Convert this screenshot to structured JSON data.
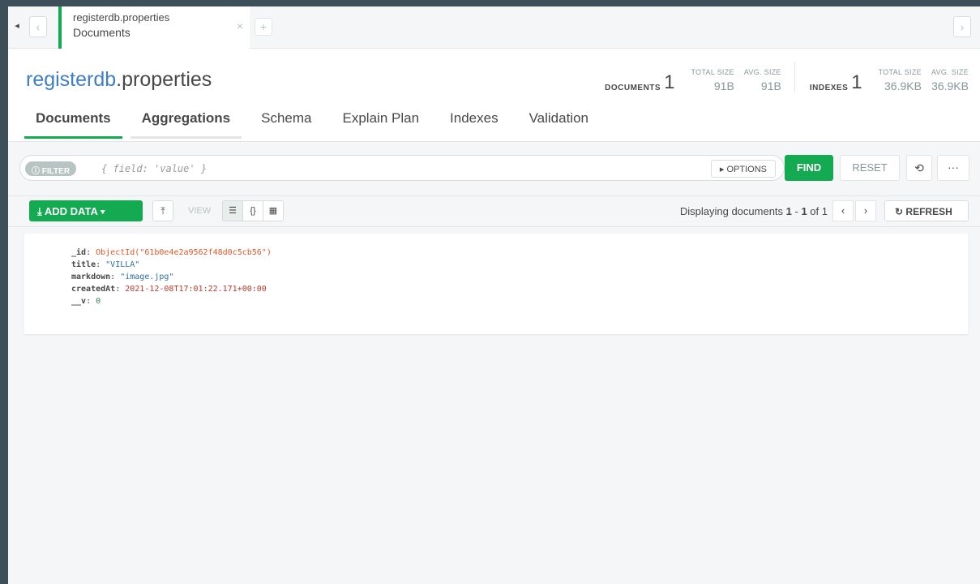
{
  "tab": {
    "title": "registerdb.properties",
    "subtitle": "Documents",
    "close_glyph": "×",
    "add_glyph": "+"
  },
  "header": {
    "db_name": "registerdb",
    "collection_name": ".properties",
    "documents_label": "DOCUMENTS",
    "documents_count": "1",
    "doc_total_size_label": "TOTAL SIZE",
    "doc_total_size": "91B",
    "doc_avg_size_label": "AVG. SIZE",
    "doc_avg_size": "91B",
    "indexes_label": "INDEXES",
    "indexes_count": "1",
    "idx_total_size_label": "TOTAL SIZE",
    "idx_total_size": "36.9KB",
    "idx_avg_size_label": "AVG. SIZE",
    "idx_avg_size": "36.9KB"
  },
  "tabs": [
    {
      "label": "Documents"
    },
    {
      "label": "Aggregations"
    },
    {
      "label": "Schema"
    },
    {
      "label": "Explain Plan"
    },
    {
      "label": "Indexes"
    },
    {
      "label": "Validation"
    }
  ],
  "query": {
    "filter_label": "FILTER",
    "filter_placeholder": "{ field: 'value' }",
    "options_label": "▸ OPTIONS",
    "find_label": "FIND",
    "reset_label": "RESET",
    "more_glyph": "···"
  },
  "toolbar": {
    "add_data_label": "ADD DATA ▾",
    "view_label": "VIEW",
    "displaying_prefix": "Displaying documents ",
    "range_start": "1",
    "range_sep": " - ",
    "range_end": "1",
    "of_text": " of ",
    "total": "1",
    "prev_glyph": "‹",
    "next_glyph": "›",
    "refresh_label": "REFRESH"
  },
  "document": {
    "fields": [
      {
        "key": "_id",
        "value": "ObjectId(\"61b0e4e2a9562f48d0c5cb56\")"
      },
      {
        "key": "title",
        "value": "\"VILLA\""
      },
      {
        "key": "markdown",
        "value": "\"image.jpg\""
      },
      {
        "key": "createdAt",
        "value": "2021-12-08T17:01:22.171+00:00"
      },
      {
        "key": "__v",
        "value": "0"
      }
    ]
  },
  "colors": {
    "accent_green": "#13aa52",
    "link_blue": "#3f7ec4",
    "chrome_dark": "#3d4f58"
  }
}
